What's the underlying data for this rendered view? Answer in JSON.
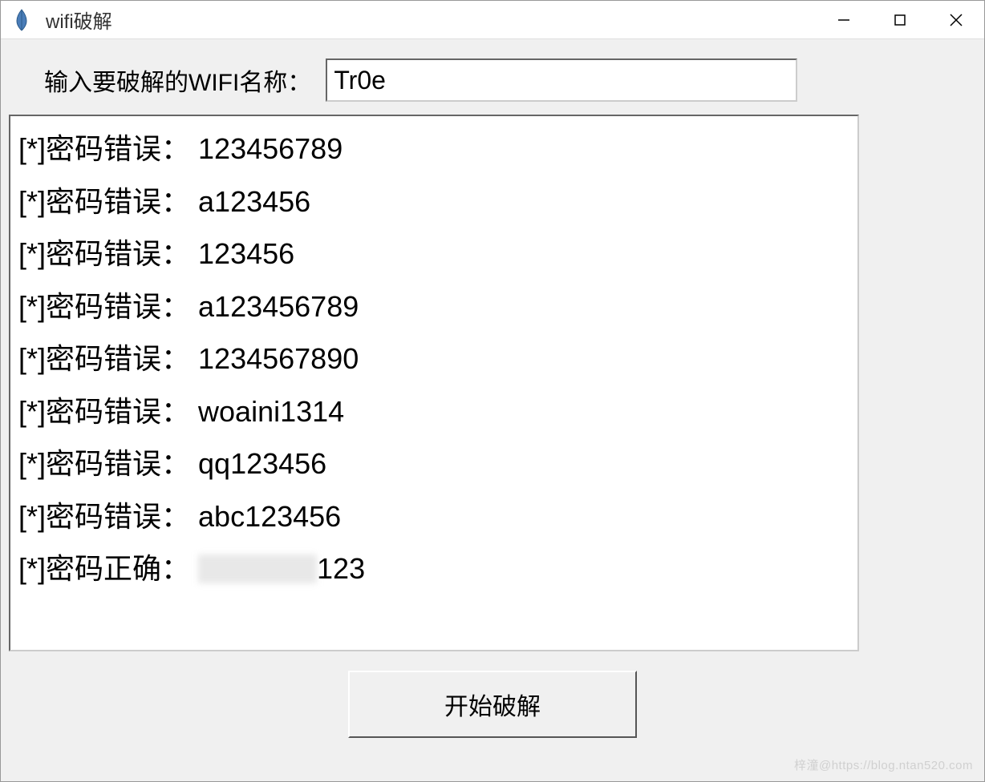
{
  "window": {
    "title": "wifi破解"
  },
  "form": {
    "input_label": "输入要破解的WIFI名称：",
    "input_value": "Tr0e",
    "start_button": "开始破解"
  },
  "log": [
    {
      "prefix": "[*]密码错误：",
      "value": "123456789",
      "redacted": false
    },
    {
      "prefix": "[*]密码错误：",
      "value": "a123456",
      "redacted": false
    },
    {
      "prefix": "[*]密码错误：",
      "value": "123456",
      "redacted": false
    },
    {
      "prefix": "[*]密码错误：",
      "value": "a123456789",
      "redacted": false
    },
    {
      "prefix": "[*]密码错误：",
      "value": "1234567890",
      "redacted": false
    },
    {
      "prefix": "[*]密码错误：",
      "value": "woaini1314",
      "redacted": false
    },
    {
      "prefix": "[*]密码错误：",
      "value": "qq123456",
      "redacted": false
    },
    {
      "prefix": "[*]密码错误：",
      "value": "abc123456",
      "redacted": false
    },
    {
      "prefix": "[*]密码正确：",
      "value": "123",
      "redacted": true
    }
  ],
  "watermark": "梓潼@https://blog.ntan520.com"
}
